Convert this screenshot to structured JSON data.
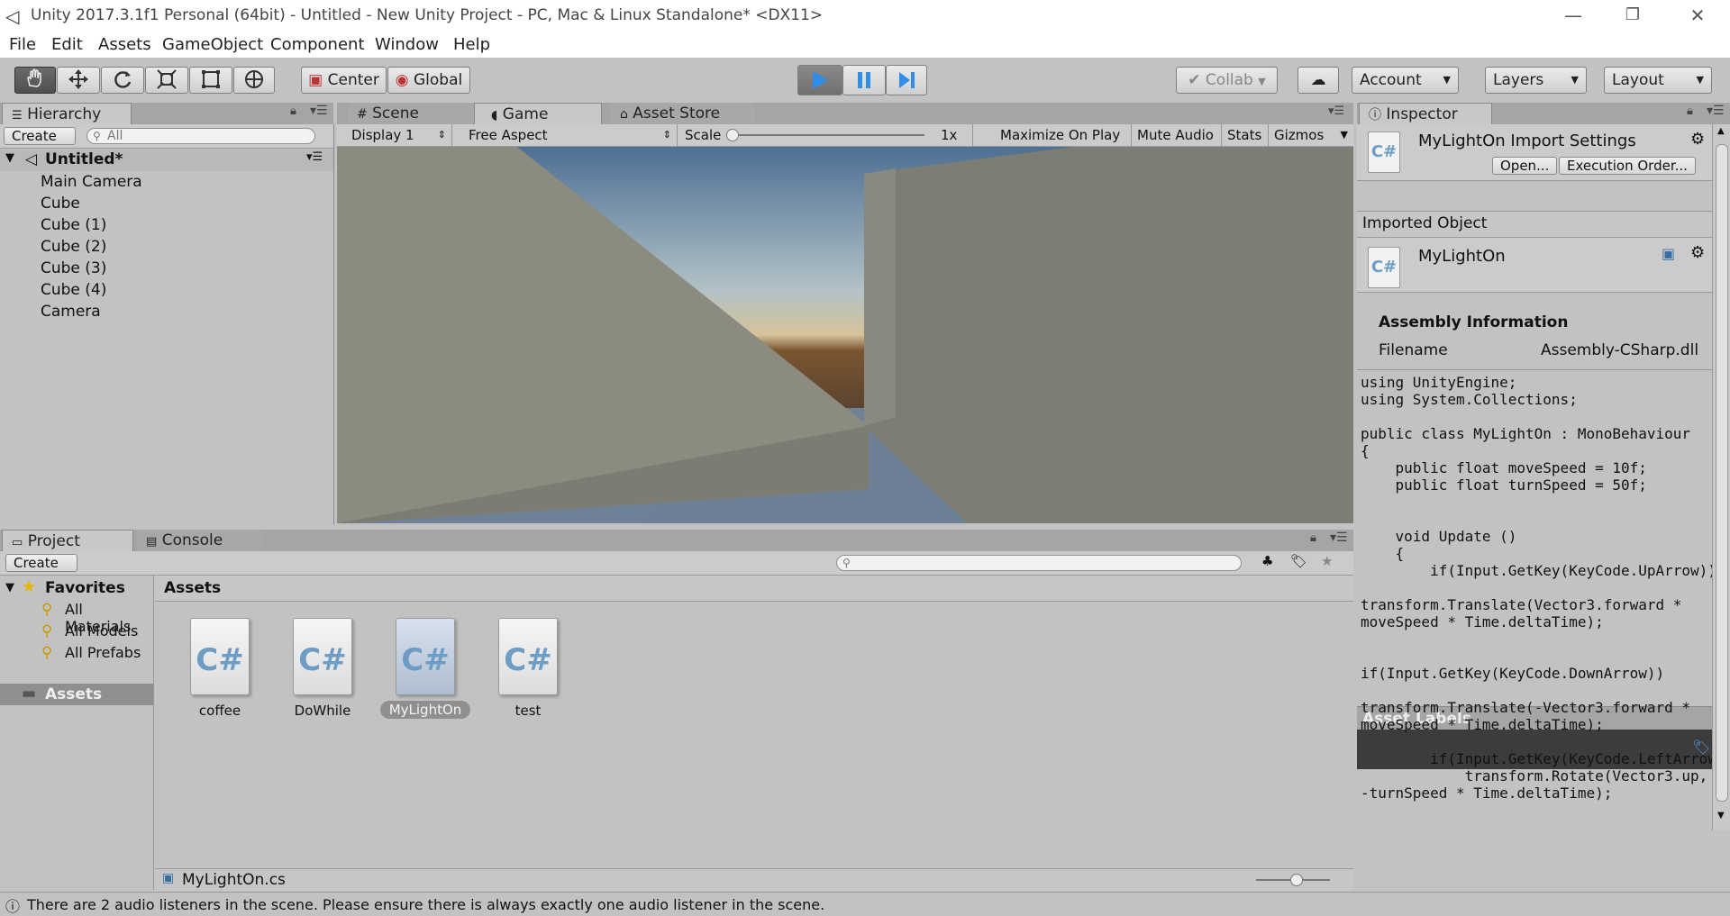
{
  "window": {
    "title": "Unity 2017.3.1f1 Personal (64bit) - Untitled - New Unity Project - PC, Mac & Linux Standalone* <DX11>",
    "minimize": "—",
    "restore": "❐",
    "close": "✕"
  },
  "menu": [
    "File",
    "Edit",
    "Assets",
    "GameObject",
    "Component",
    "Window",
    "Help"
  ],
  "toolbar": {
    "pivot": "Center",
    "space": "Global",
    "collab": "Collab",
    "account": "Account",
    "layers": "Layers",
    "layout": "Layout",
    "tools": [
      "hand-tool-icon",
      "move-tool-icon",
      "rotate-tool-icon",
      "scale-tool-icon",
      "rect-tool-icon",
      "transform-tool-icon"
    ]
  },
  "hierarchy": {
    "tab": "Hierarchy",
    "create": "Create",
    "search_placeholder": "All",
    "scene": "Untitled*",
    "items": [
      "Main Camera",
      "Cube",
      "Cube (1)",
      "Cube (2)",
      "Cube (3)",
      "Cube (4)",
      "Camera"
    ]
  },
  "center_tabs": {
    "scene": "Scene",
    "game": "Game",
    "asset_store": "Asset Store"
  },
  "gamebar": {
    "display": "Display 1",
    "aspect": "Free Aspect",
    "scale_label": "Scale",
    "scale_value": "1x",
    "maximize": "Maximize On Play",
    "mute": "Mute Audio",
    "stats": "Stats",
    "gizmos": "Gizmos"
  },
  "inspector": {
    "tab": "Inspector",
    "header_title": "MyLightOn Import Settings",
    "open": "Open...",
    "execution_order": "Execution Order...",
    "imported_object": "Imported Object",
    "object_name": "MyLightOn",
    "assembly_info": "Assembly Information",
    "filename_label": "Filename",
    "filename_value": "Assembly-CSharp.dll",
    "code": [
      "using UnityEngine;",
      "using System.Collections;",
      "",
      "public class MyLightOn : MonoBehaviour",
      "{",
      "    public float moveSpeed = 10f;",
      "    public float turnSpeed = 50f;",
      "",
      "",
      "    void Update ()",
      "    {",
      "        if(Input.GetKey(KeyCode.UpArrow))",
      "",
      "transform.Translate(Vector3.forward *",
      "moveSpeed * Time.deltaTime);",
      "",
      "",
      "if(Input.GetKey(KeyCode.DownArrow))",
      "",
      "transform.Translate(-Vector3.forward *",
      "moveSpeed * Time.deltaTime);",
      "",
      "        if(Input.GetKey(KeyCode.LeftArrow))",
      "            transform.Rotate(Vector3.up,",
      "-turnSpeed * Time.deltaTime);"
    ],
    "asset_labels": "Asset Labels"
  },
  "project": {
    "tab": "Project",
    "console_tab": "Console",
    "create": "Create",
    "favorites": "Favorites",
    "favorite_items": [
      "All Materials",
      "All Models",
      "All Prefabs"
    ],
    "assets_folder": "Assets",
    "breadcrumb": "Assets",
    "files": [
      "coffee",
      "DoWhile",
      "MyLightOn",
      "test"
    ],
    "selected_file": "MyLightOn.cs"
  },
  "status": {
    "message": "There are 2 audio listeners in the scene. Please ensure there is always exactly one audio listener in the scene."
  },
  "colors": {
    "editor_bg": "#c2c2c2",
    "selection": "#8fa8cc",
    "play_accent": "#2f8fe8"
  }
}
